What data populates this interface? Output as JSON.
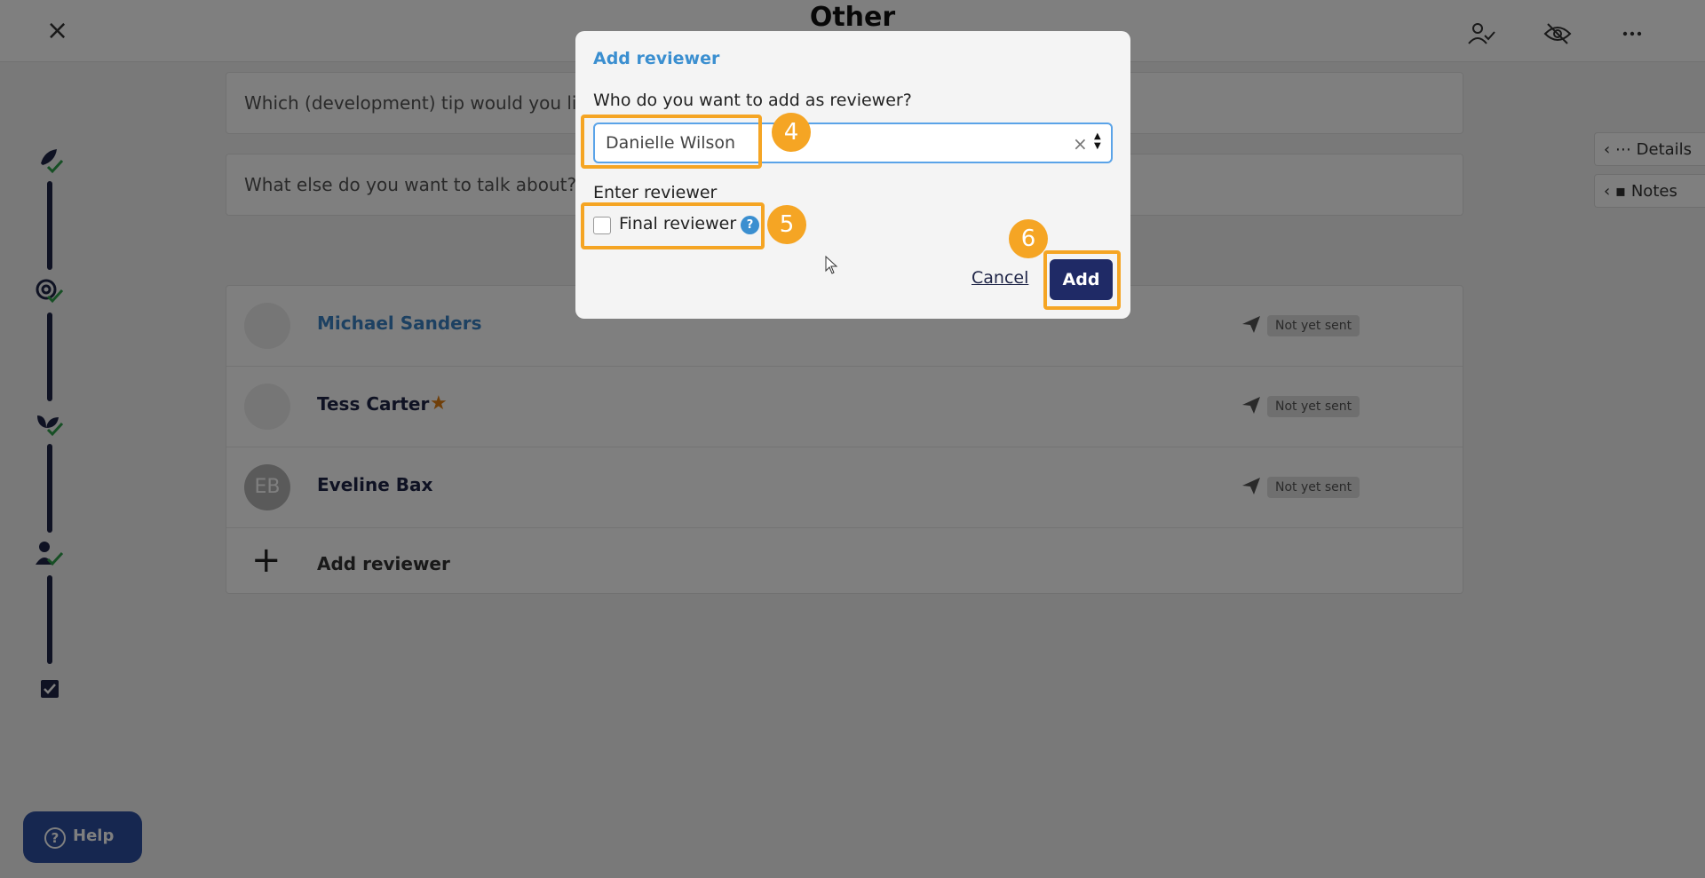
{
  "header": {
    "title": "Other",
    "close_icon": "close-icon",
    "icons": [
      "user-check-icon",
      "eye-off-icon",
      "more-icon"
    ]
  },
  "questions": [
    "Which (development) tip would you like to share?",
    "What else do you want to talk about?"
  ],
  "side_tabs": {
    "details": "Details",
    "notes": "Notes"
  },
  "reviewers": [
    {
      "name": "Michael Sanders",
      "status": "Not yet sent",
      "linked": true
    },
    {
      "name": "Tess Carter",
      "status": "Not yet sent",
      "final": true
    },
    {
      "name": "Eveline Bax",
      "initials": "EB",
      "status": "Not yet sent"
    }
  ],
  "add_reviewer_label": "Add reviewer",
  "help": {
    "label": "Help"
  },
  "modal": {
    "title": "Add reviewer",
    "question": "Who do you want to add as reviewer?",
    "select_value": "Danielle Wilson",
    "select_clear": "×",
    "sub_label": "Enter reviewer",
    "checkbox_label": "Final reviewer",
    "info_mark": "?",
    "cancel_label": "Cancel",
    "add_label": "Add"
  },
  "steps": [
    "4",
    "5",
    "6"
  ],
  "colors": {
    "accent": "#3b8fd0",
    "navy": "#1f2a66",
    "callout": "#f5a524",
    "check": "#2e9e4b",
    "star": "#e07f12"
  }
}
